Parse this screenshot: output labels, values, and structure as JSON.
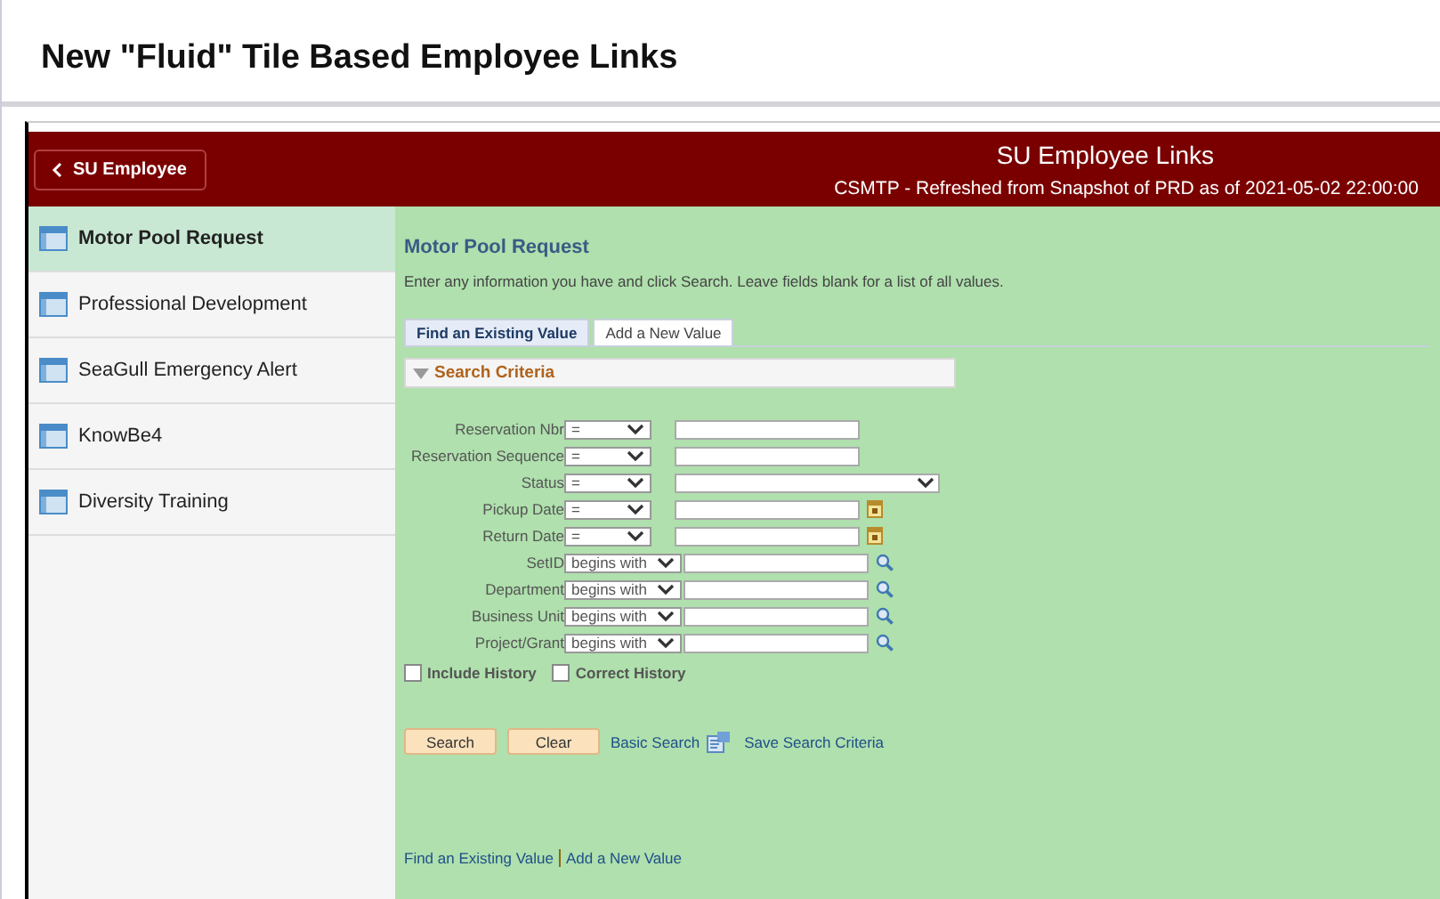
{
  "page_title": "New \"Fluid\" Tile Based Employee Links",
  "header": {
    "back_button": "SU Employee",
    "title": "SU Employee Links",
    "subtitle": "CSMTP - Refreshed from Snapshot of PRD as of 2021-05-02 22:00:00"
  },
  "sidebar": {
    "items": [
      {
        "label": "Motor Pool Request",
        "selected": true
      },
      {
        "label": "Professional Development",
        "selected": false
      },
      {
        "label": "SeaGull Emergency Alert",
        "selected": false
      },
      {
        "label": "KnowBe4",
        "selected": false
      },
      {
        "label": "Diversity Training",
        "selected": false
      }
    ]
  },
  "content": {
    "title": "Motor Pool Request",
    "instructions": "Enter any information you have and click Search. Leave fields blank for a list of all values.",
    "tabs": [
      {
        "label": "Find an Existing Value",
        "selected": true
      },
      {
        "label": "Add a New Value",
        "selected": false
      }
    ],
    "section": {
      "label": "Search Criteria",
      "expanded": true
    },
    "fields": [
      {
        "label": "Reservation Nbr",
        "operator": "=",
        "kind": "text"
      },
      {
        "label": "Reservation Sequence",
        "operator": "=",
        "kind": "text"
      },
      {
        "label": "Status",
        "operator": "=",
        "kind": "select"
      },
      {
        "label": "Pickup Date",
        "operator": "=",
        "kind": "date"
      },
      {
        "label": "Return Date",
        "operator": "=",
        "kind": "date"
      },
      {
        "label": "SetID",
        "operator": "begins with",
        "kind": "lookup"
      },
      {
        "label": "Department",
        "operator": "begins with",
        "kind": "lookup"
      },
      {
        "label": "Business Unit",
        "operator": "begins with",
        "kind": "lookup"
      },
      {
        "label": "Project/Grant",
        "operator": "begins with",
        "kind": "lookup"
      }
    ],
    "checkboxes": [
      {
        "label": "Include History",
        "checked": false
      },
      {
        "label": "Correct History",
        "checked": false
      }
    ],
    "buttons": [
      "Search",
      "Clear"
    ],
    "links": {
      "basic_search": "Basic Search",
      "save_search": "Save Search Criteria"
    },
    "footer_links": [
      "Find an Existing Value",
      "Add a New Value"
    ]
  }
}
